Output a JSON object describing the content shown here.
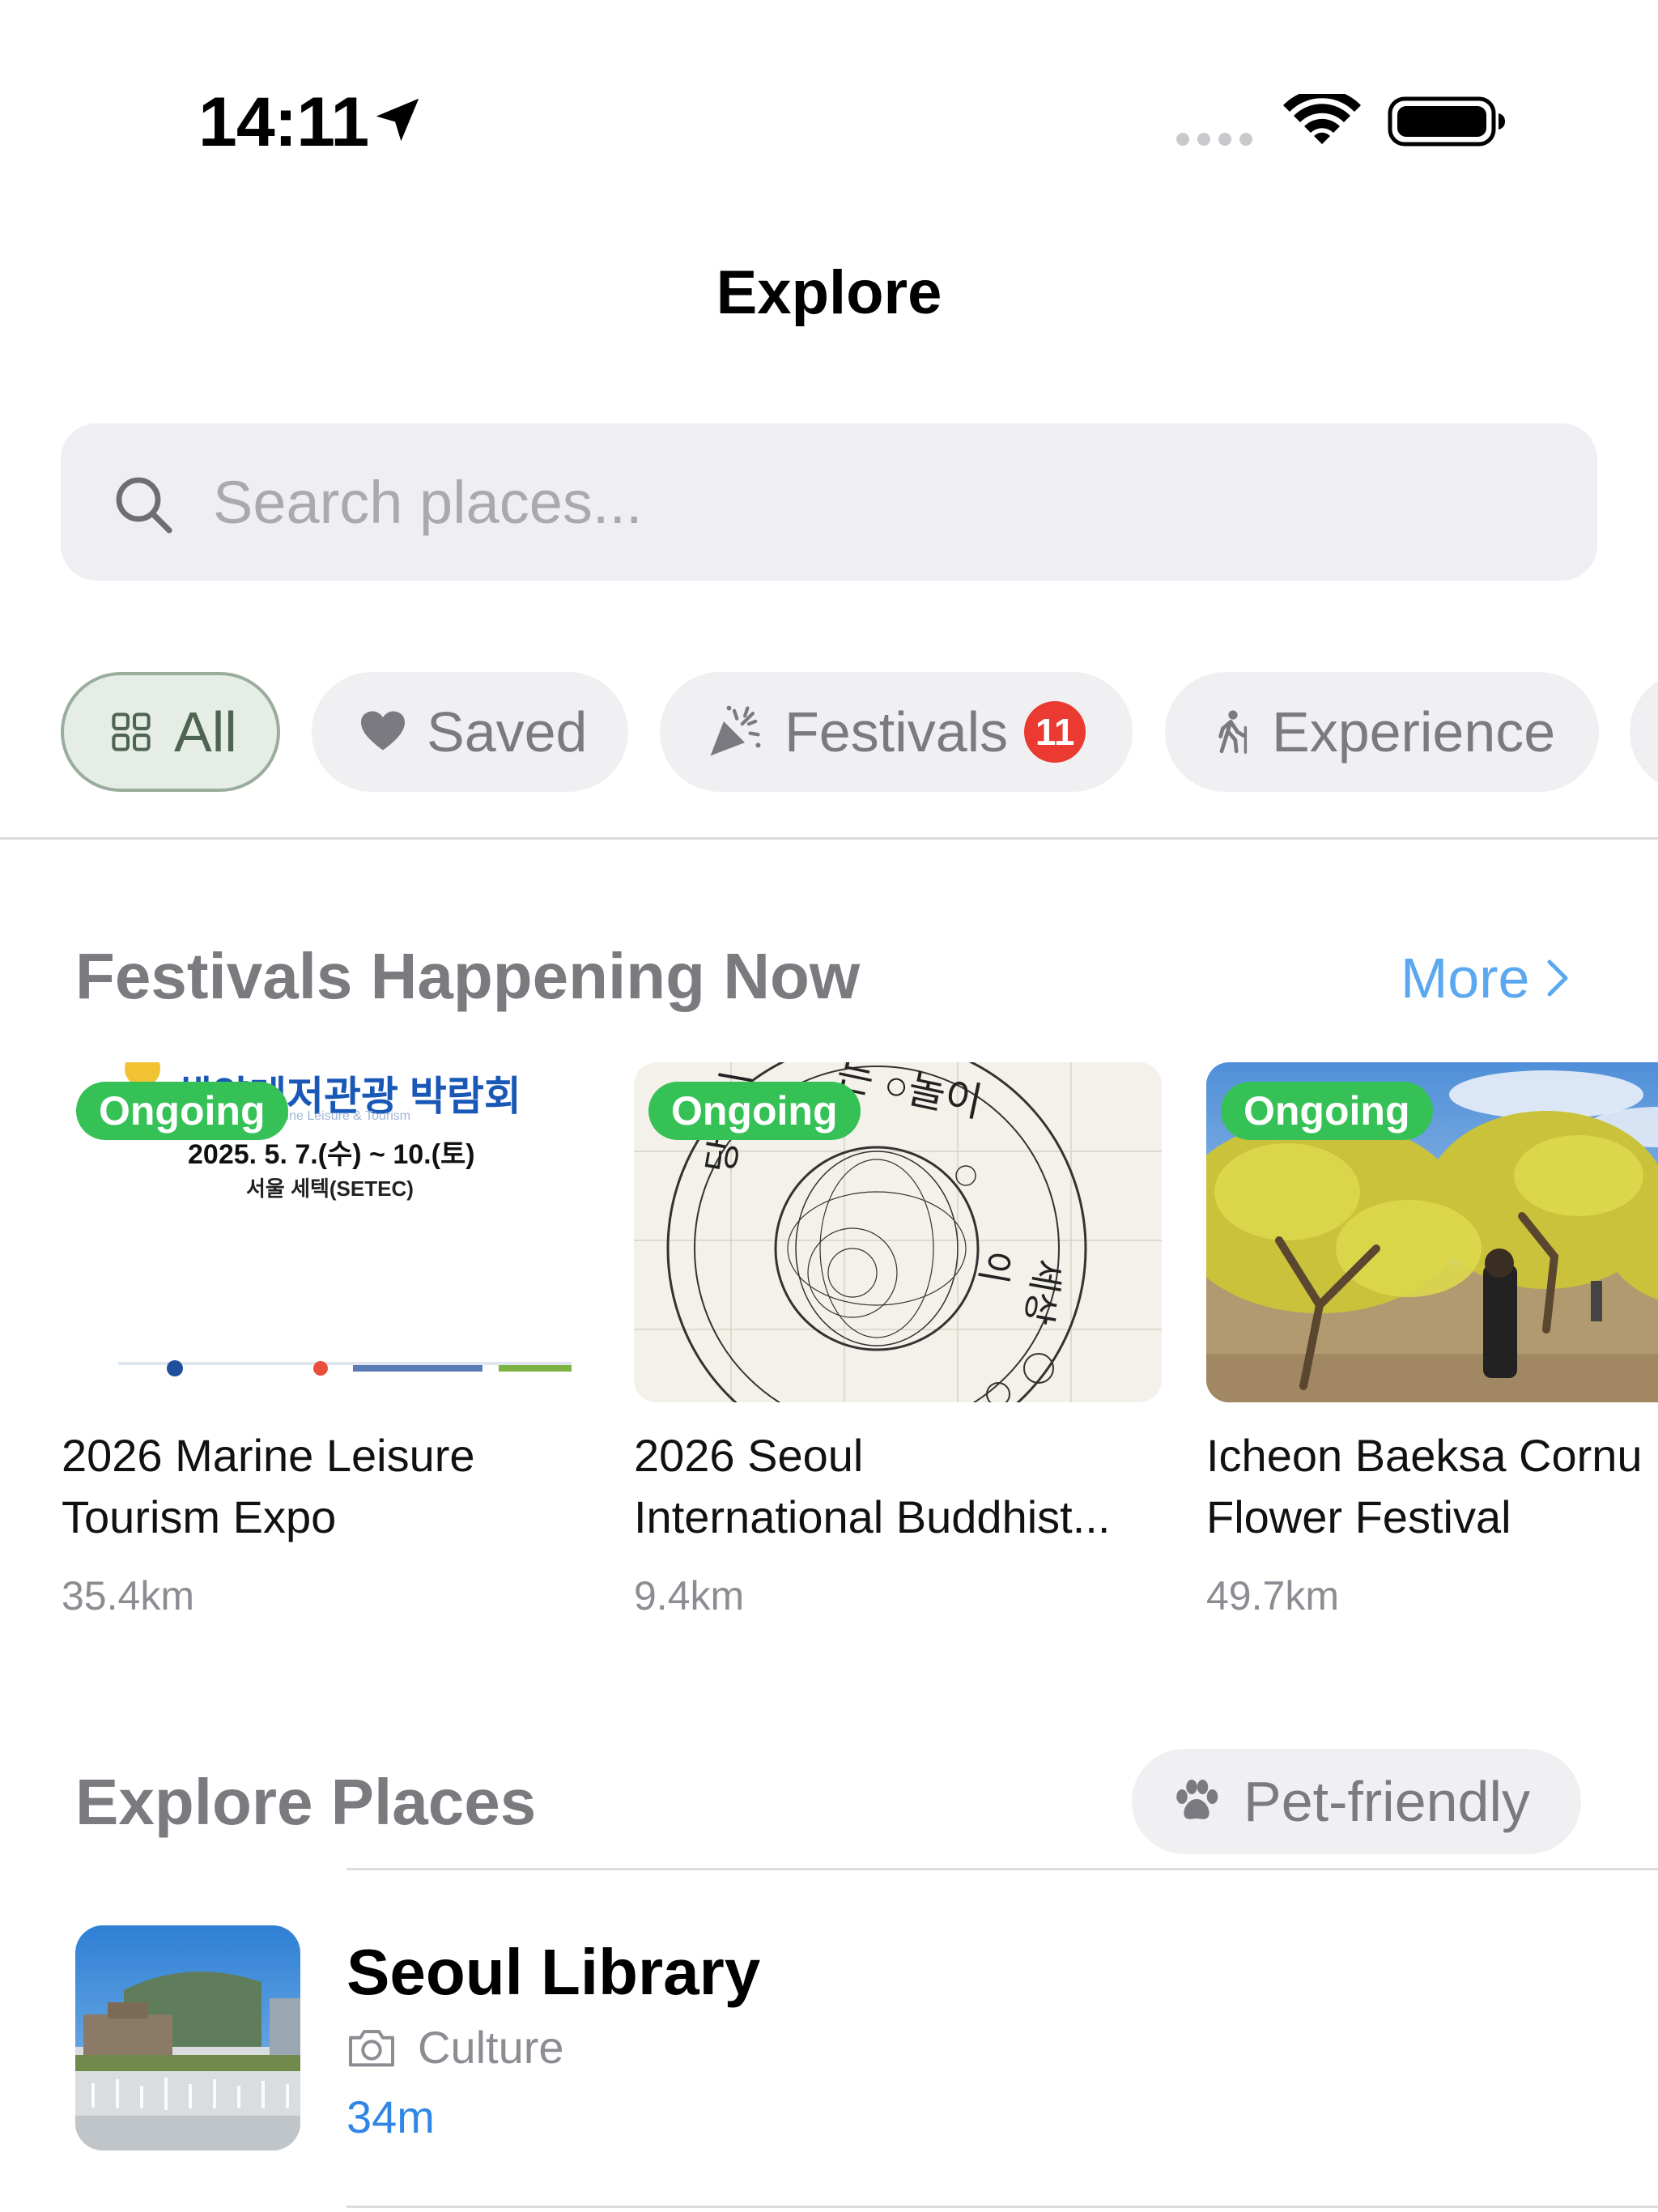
{
  "status_bar": {
    "time": "14:11"
  },
  "nav": {
    "title": "Explore"
  },
  "search": {
    "placeholder": "Search places..."
  },
  "filters": [
    {
      "label": "All",
      "icon": "grid-icon",
      "active": true
    },
    {
      "label": "Saved",
      "icon": "heart-icon"
    },
    {
      "label": "Festivals",
      "icon": "party-popper-icon",
      "badge": "11"
    },
    {
      "label": "Experience",
      "icon": "hiker-icon"
    }
  ],
  "festivals_section": {
    "title": "Festivals Happening Now",
    "more_label": "More",
    "cards": [
      {
        "status": "Ongoing",
        "title_line1": "2026 Marine Leisure",
        "title_line2": "Tourism Expo",
        "distance": "35.4km",
        "poster": {
          "heading": "해양레저관광 박람회",
          "subheading": "Marine Leisure & Tourism",
          "date": "2025. 5. 7.(수) ~ 10.(토)",
          "venue": "서울 세텍(SETEC)"
        }
      },
      {
        "status": "Ongoing",
        "title_line1": "2026 Seoul",
        "title_line2": "International Buddhist...",
        "distance": "9.4km",
        "poster": {
          "top_text": "는 ○놀이",
          "left_text": "당신이",
          "right_text": "세상이"
        }
      },
      {
        "status": "Ongoing",
        "title_line1": "Icheon Baeksa Cornu",
        "title_line2": "Flower Festival",
        "distance": "49.7km"
      }
    ]
  },
  "places_section": {
    "title": "Explore Places",
    "pet_filter_label": "Pet-friendly",
    "items": [
      {
        "name": "Seoul Library",
        "category": "Culture",
        "category_icon": "camera-icon",
        "distance": "34m"
      }
    ]
  },
  "colors": {
    "accent_blue": "#2f86e6",
    "more_blue": "#5aa8ef",
    "ongoing_green": "#36c156",
    "badge_red": "#ea3a32",
    "active_chip_bg": "#e6ece6"
  }
}
